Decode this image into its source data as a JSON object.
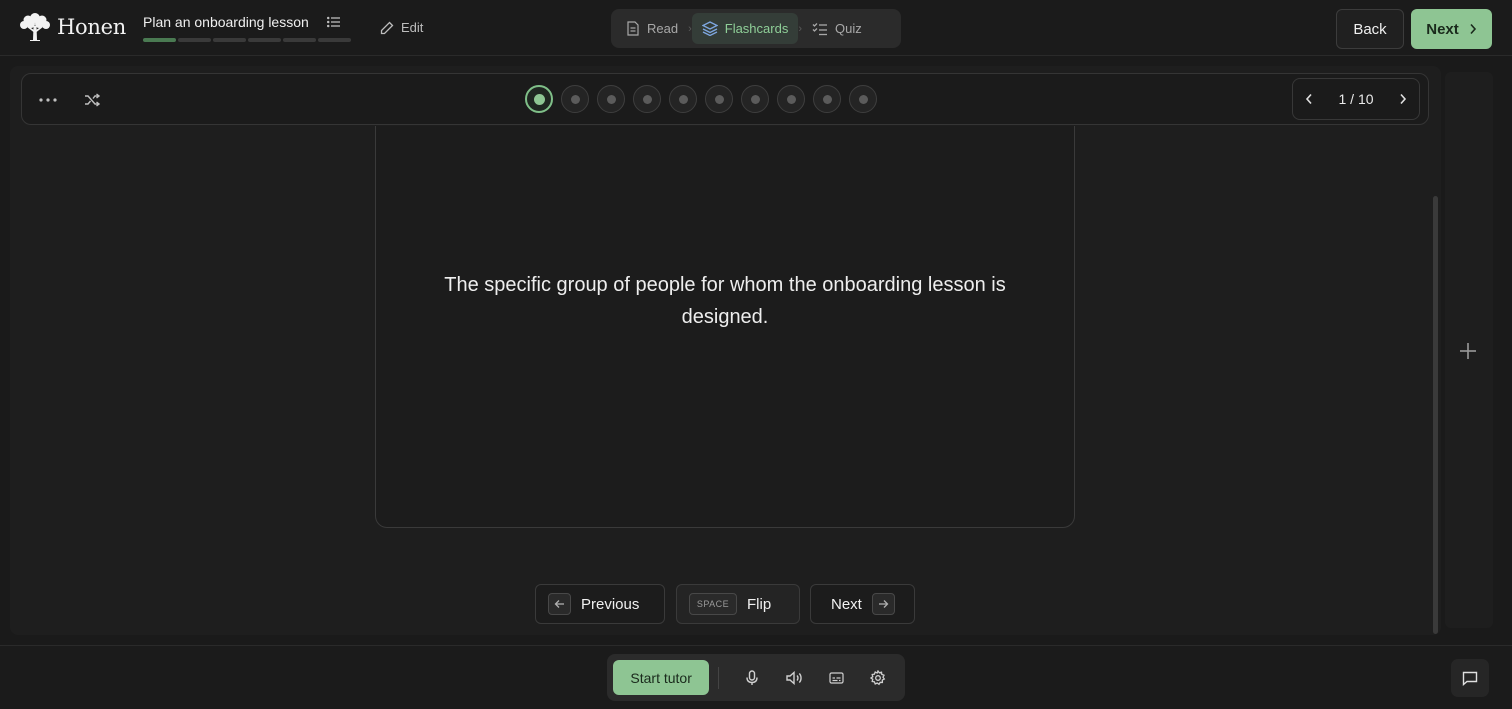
{
  "app": {
    "name": "Honen"
  },
  "lesson": {
    "title": "Plan an onboarding lesson",
    "progress_done": 1,
    "progress_total": 6,
    "edit_label": "Edit"
  },
  "modes": [
    {
      "label": "Read",
      "icon": "document-icon"
    },
    {
      "label": "Flashcards",
      "icon": "layers-icon"
    },
    {
      "label": "Quiz",
      "icon": "checklist-icon"
    }
  ],
  "nav": {
    "back_label": "Back",
    "next_label": "Next"
  },
  "deck": {
    "current": 1,
    "total": 10,
    "counter": "1 / 10"
  },
  "card": {
    "text": "The specific group of people for whom the onboarding lesson is designed."
  },
  "controls": {
    "previous_label": "Previous",
    "flip_key": "SPACE",
    "flip_label": "Flip",
    "next_label": "Next"
  },
  "tutor": {
    "start_label": "Start tutor"
  },
  "colors": {
    "accent": "#8ec593",
    "background": "#1a1a1a"
  }
}
